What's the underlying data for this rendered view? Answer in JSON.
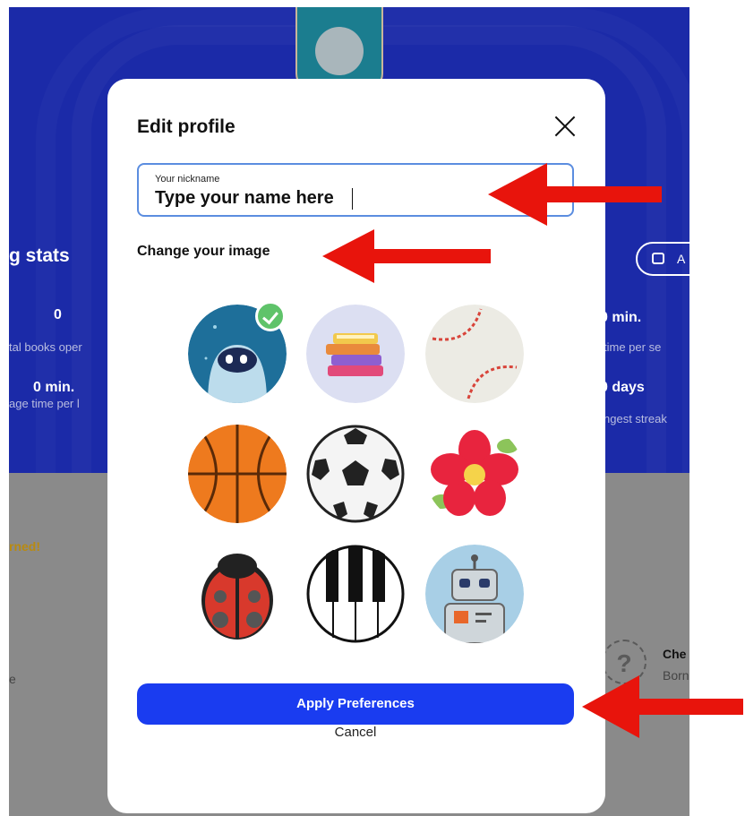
{
  "background": {
    "stats_heading": "g stats",
    "left_stat1_value": "0",
    "left_stat1_label": "tal books oper",
    "left_stat2_value": "0 min.",
    "left_stat2_label": "age time per l",
    "right_stat1_value": "0 min.",
    "right_stat1_label": "time per se",
    "right_stat2_value": "0 days",
    "right_stat2_label": "ngest streak",
    "pill_label": "A",
    "earned_text": "rned!",
    "side_letter": "e",
    "q_mark": "?",
    "card_title": "Che",
    "card_sub": "Born"
  },
  "modal": {
    "title": "Edit profile",
    "close_icon": "close-icon",
    "nickname_label": "Your nickname",
    "nickname_value": "Type your name here",
    "change_image_label": "Change your image",
    "avatars": [
      {
        "name": "robot-astronaut",
        "selected": true
      },
      {
        "name": "books"
      },
      {
        "name": "baseball"
      },
      {
        "name": "basketball"
      },
      {
        "name": "soccer-ball"
      },
      {
        "name": "flower"
      },
      {
        "name": "ladybug"
      },
      {
        "name": "piano-keys"
      },
      {
        "name": "robot"
      }
    ],
    "apply_label": "Apply Preferences",
    "cancel_label": "Cancel"
  },
  "colors": {
    "accent": "#1a3cf0",
    "annotation_arrow": "#e8140c",
    "selected_check": "#5fc36a"
  }
}
